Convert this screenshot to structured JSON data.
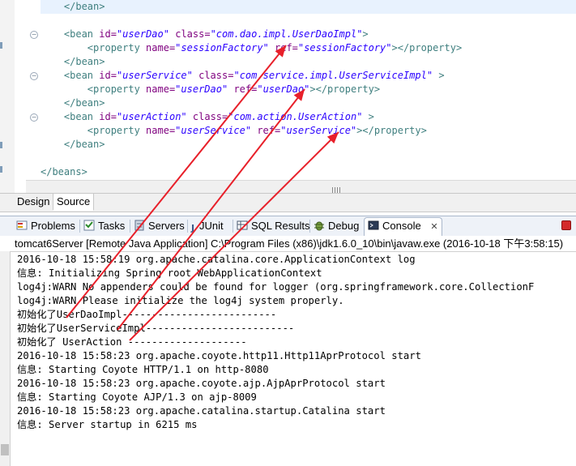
{
  "editor": {
    "lines": [
      {
        "indent": "    ",
        "parts": [
          {
            "c": "t",
            "s": "</bean>"
          }
        ]
      },
      {
        "indent": "",
        "parts": []
      },
      {
        "indent": "    ",
        "parts": [
          {
            "c": "t",
            "s": "<bean "
          },
          {
            "c": "a",
            "s": "id="
          },
          {
            "c": "v",
            "s": "\"userDao\""
          },
          {
            "c": "p",
            "s": " "
          },
          {
            "c": "a",
            "s": "class="
          },
          {
            "c": "v",
            "s": "\"com.dao.impl.UserDaoImpl\""
          },
          {
            "c": "t",
            "s": ">"
          }
        ]
      },
      {
        "indent": "        ",
        "parts": [
          {
            "c": "t",
            "s": "<property "
          },
          {
            "c": "a",
            "s": "name="
          },
          {
            "c": "v",
            "s": "\"sessionFactory\""
          },
          {
            "c": "p",
            "s": " "
          },
          {
            "c": "a",
            "s": "ref="
          },
          {
            "c": "v",
            "s": "\"sessionFactory\""
          },
          {
            "c": "t",
            "s": "></property>"
          }
        ]
      },
      {
        "indent": "    ",
        "parts": [
          {
            "c": "t",
            "s": "</bean>"
          }
        ]
      },
      {
        "indent": "    ",
        "parts": [
          {
            "c": "t",
            "s": "<bean "
          },
          {
            "c": "a",
            "s": "id="
          },
          {
            "c": "v",
            "s": "\"userService\""
          },
          {
            "c": "p",
            "s": " "
          },
          {
            "c": "a",
            "s": "class="
          },
          {
            "c": "v",
            "s": "\"com.service.impl.UserServiceImpl\""
          },
          {
            "c": "p",
            "s": " "
          },
          {
            "c": "t",
            "s": ">"
          }
        ]
      },
      {
        "indent": "        ",
        "parts": [
          {
            "c": "t",
            "s": "<property "
          },
          {
            "c": "a",
            "s": "name="
          },
          {
            "c": "v",
            "s": "\"userDao\""
          },
          {
            "c": "p",
            "s": " "
          },
          {
            "c": "a",
            "s": "ref="
          },
          {
            "c": "v",
            "s": "\"userDao\""
          },
          {
            "c": "t",
            "s": "></property>"
          }
        ]
      },
      {
        "indent": "    ",
        "parts": [
          {
            "c": "t",
            "s": "</bean>"
          }
        ]
      },
      {
        "indent": "    ",
        "parts": [
          {
            "c": "t",
            "s": "<bean "
          },
          {
            "c": "a",
            "s": "id="
          },
          {
            "c": "v",
            "s": "\"userAction\""
          },
          {
            "c": "p",
            "s": " "
          },
          {
            "c": "a",
            "s": "class="
          },
          {
            "c": "v",
            "s": "\"com.action.UserAction\""
          },
          {
            "c": "p",
            "s": " "
          },
          {
            "c": "t",
            "s": ">"
          }
        ]
      },
      {
        "indent": "        ",
        "parts": [
          {
            "c": "t",
            "s": "<property "
          },
          {
            "c": "a",
            "s": "name="
          },
          {
            "c": "v",
            "s": "\"userService\""
          },
          {
            "c": "p",
            "s": " "
          },
          {
            "c": "a",
            "s": "ref="
          },
          {
            "c": "v",
            "s": "\"userService\""
          },
          {
            "c": "t",
            "s": "></property>"
          }
        ]
      },
      {
        "indent": "    ",
        "parts": [
          {
            "c": "t",
            "s": "</bean>"
          }
        ]
      },
      {
        "indent": "",
        "parts": []
      },
      {
        "indent": "",
        "parts": [
          {
            "c": "t",
            "s": "</beans>"
          }
        ]
      }
    ]
  },
  "editor_tabs": {
    "design": "Design",
    "source": "Source"
  },
  "views": {
    "problems": "Problems",
    "tasks": "Tasks",
    "servers": "Servers",
    "junit": "JUnit",
    "sql_results": "SQL Results",
    "debug": "Debug",
    "console": "Console",
    "close_glyph": "✕"
  },
  "console": {
    "description": "tomcat6Server [Remote Java Application] C:\\Program Files (x86)\\jdk1.6.0_10\\bin\\javaw.exe (2016-10-18 下午3:58:15)",
    "lines": [
      "2016-10-18 15:58:19 org.apache.catalina.core.ApplicationContext log",
      "信息: Initializing Spring root WebApplicationContext",
      "log4j:WARN No appenders could be found for logger (org.springframework.core.CollectionF",
      "log4j:WARN Please initialize the log4j system properly.",
      "初始化了UserDaoImpl--------------------------",
      "初始化了UserServiceImpl-------------------------",
      "初始化了 UserAction --------------------",
      "2016-10-18 15:58:23 org.apache.coyote.http11.Http11AprProtocol start",
      "信息: Starting Coyote HTTP/1.1 on http-8080",
      "2016-10-18 15:58:23 org.apache.coyote.ajp.AjpAprProtocol start",
      "信息: Starting Coyote AJP/1.3 on ajp-8009",
      "2016-10-18 15:58:23 org.apache.catalina.startup.Catalina start",
      "信息: Server startup in 6215 ms"
    ]
  },
  "colors": {
    "arrow": "#e8202a",
    "tag": "#3f7f7f",
    "attr": "#7f007f",
    "value": "#2a00ff"
  }
}
